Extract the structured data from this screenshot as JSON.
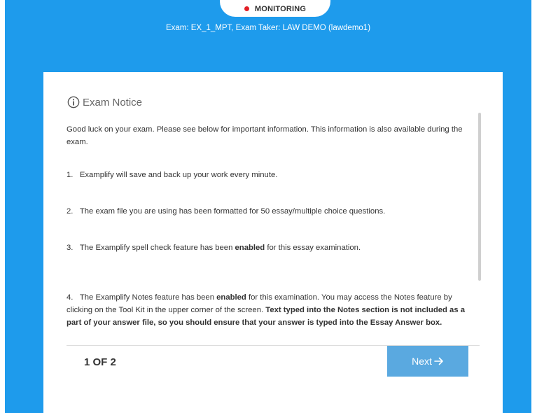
{
  "header": {
    "monitoring_label": "MONITORING",
    "exam_info": "Exam: EX_1_MPT, Exam Taker: LAW DEMO (lawdemo1)"
  },
  "notice": {
    "title": "Exam Notice",
    "icon": "info-icon",
    "intro": "Good luck on your exam. Please see below for important information. This information is also available during the exam.",
    "items": [
      {
        "number": "1.",
        "text": "Examplify will save and back up your work every minute."
      },
      {
        "number": "2.",
        "text": "The exam file you are using has been formatted for 50 essay/multiple choice questions."
      },
      {
        "number": "3.",
        "pre": "The Examplify spell check feature has been ",
        "bold": "enabled",
        "post": " for this essay examination."
      },
      {
        "number": "4.",
        "pre": "The Examplify Notes feature has been ",
        "bold": "enabled",
        "mid": " for this examination. You may access the Notes feature by clicking on the Tool Kit in the upper corner of the screen. ",
        "bold2": "Text typed into the Notes section is not included as a part of your answer file, so you should ensure that your answer is typed into the Essay Answer box."
      }
    ]
  },
  "footer": {
    "page_indicator": "1 OF 2",
    "next_label": "Next"
  },
  "colors": {
    "background": "#1e9bec",
    "button": "#5aa9e0",
    "monitoring_dot": "#e21f26"
  }
}
